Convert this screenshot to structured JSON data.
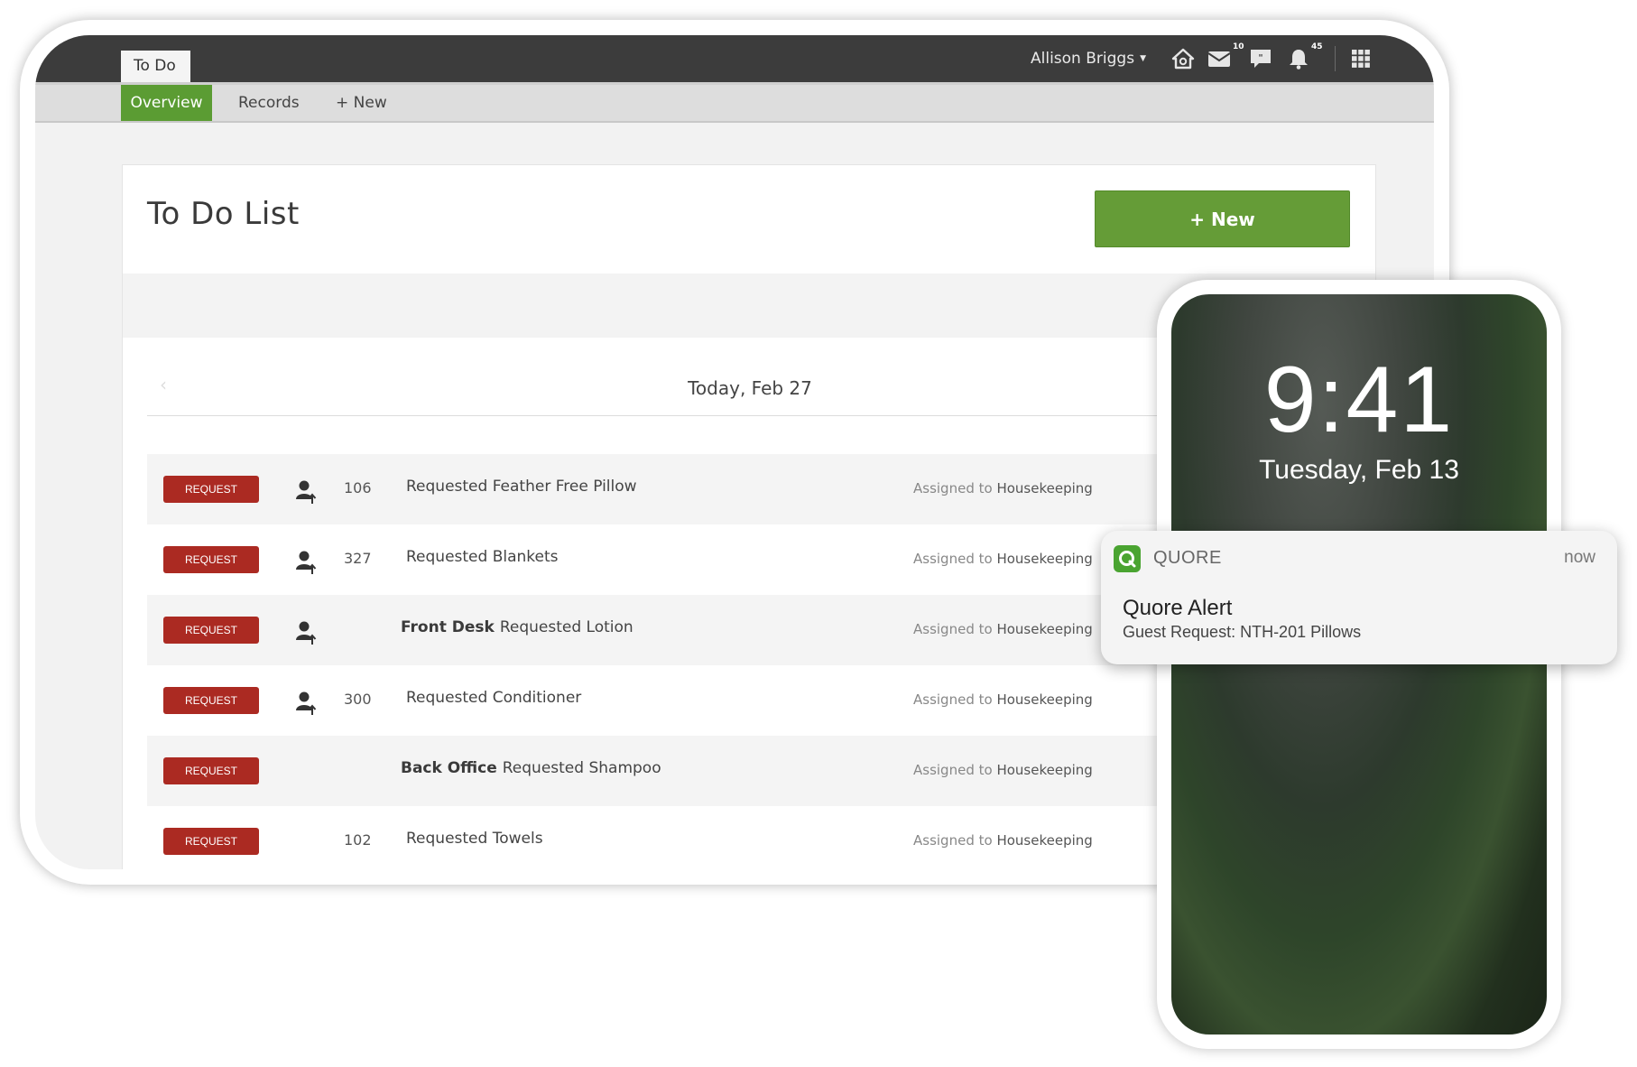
{
  "header": {
    "app_tab": "To Do",
    "user_name": "Allison Briggs",
    "mail_badge": "10",
    "bell_badge": "45"
  },
  "subnav": {
    "overview": "Overview",
    "records": "Records",
    "new": "+ New"
  },
  "card": {
    "title": "To Do List",
    "new_button": "+ New",
    "date": "Today, Feb 27",
    "prev_arrow": "‹"
  },
  "rows": [
    {
      "badge": "REQUEST",
      "room": "106",
      "location": "",
      "description": "Requested Feather Free Pillow",
      "assigned_prefix": "Assigned to",
      "team": "Housekeeping"
    },
    {
      "badge": "REQUEST",
      "room": "327",
      "location": "",
      "description": "Requested Blankets",
      "assigned_prefix": "Assigned to",
      "team": "Housekeeping"
    },
    {
      "badge": "REQUEST",
      "room": "",
      "location": "Front Desk",
      "description": "Requested Lotion",
      "assigned_prefix": "Assigned to",
      "team": "Housekeeping"
    },
    {
      "badge": "REQUEST",
      "room": "300",
      "location": "",
      "description": "Requested Conditioner",
      "assigned_prefix": "Assigned to",
      "team": "Housekeeping"
    },
    {
      "badge": "REQUEST",
      "room": "",
      "location": "Back Office",
      "description": "Requested Shampoo",
      "assigned_prefix": "Assigned to",
      "team": "Housekeeping"
    },
    {
      "badge": "REQUEST",
      "room": "102",
      "location": "",
      "description": "Requested Towels",
      "assigned_prefix": "Assigned to",
      "team": "Housekeeping"
    }
  ],
  "phone": {
    "time": "9:41",
    "date": "Tuesday, Feb 13"
  },
  "notification": {
    "app_name": "QUORE",
    "time": "now",
    "title": "Quore Alert",
    "body": "Guest Request: NTH-201 Pillows"
  },
  "colors": {
    "brand_green": "#659c37",
    "request_red": "#ab2a22",
    "topbar": "#3c3c3c"
  },
  "icons": [
    "home-icon",
    "mail-icon",
    "chat-icon",
    "bell-icon",
    "grid-icon",
    "person-arrow-icon",
    "quore-logo-icon"
  ]
}
